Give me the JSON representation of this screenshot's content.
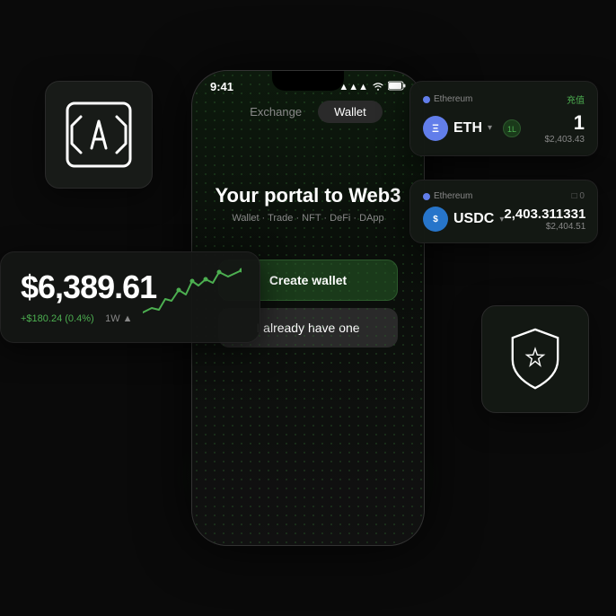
{
  "status_bar": {
    "time": "9:41",
    "signal": "●●●",
    "wifi": "WiFi",
    "battery": "Battery"
  },
  "tabs": {
    "exchange": "Exchange",
    "wallet": "Wallet"
  },
  "hero": {
    "title": "Your portal to Web3",
    "subtitle": "Wallet · Trade · NFT · DeFi · DApp"
  },
  "buttons": {
    "create_wallet": "Create wallet",
    "have_one": "I already have one"
  },
  "balance_card": {
    "amount": "$6,389.61",
    "change": "+$180.24 (0.4%)",
    "period": "1W ▲"
  },
  "eth_card": {
    "chain": "Ethereum",
    "token": "ETH",
    "amount": "1",
    "usd": "$2,403.43",
    "badge": "1L",
    "top_right": "充值"
  },
  "usdc_card": {
    "chain": "Ethereum",
    "token": "USDC",
    "amount": "2,403.311331",
    "usd": "$2,404.51"
  },
  "icon_card": {
    "symbol": "{[a]}"
  },
  "shield_card": {
    "label": "shield"
  }
}
